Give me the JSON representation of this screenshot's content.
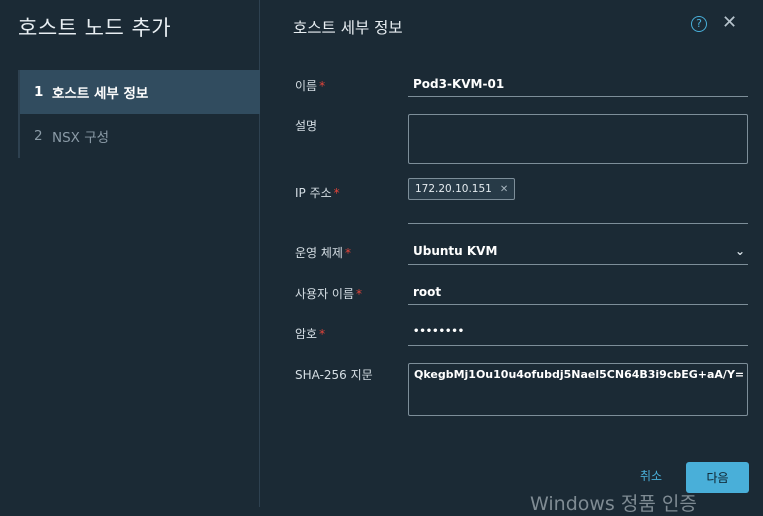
{
  "wizard": {
    "title": "호스트 노드 추가",
    "steps": [
      {
        "num": "1",
        "label": "호스트 세부 정보"
      },
      {
        "num": "2",
        "label": "NSX 구성"
      }
    ]
  },
  "section": {
    "title": "호스트 세부 정보"
  },
  "icons": {
    "help": "help-circle-icon",
    "close": "close-icon",
    "chip_remove": "remove-icon",
    "dropdown": "chevron-down-icon"
  },
  "form": {
    "name": {
      "label": "이름",
      "value": "Pod3-KVM-01"
    },
    "description": {
      "label": "설명",
      "value": ""
    },
    "ip": {
      "label": "IP 주소",
      "chip": "172.20.10.151"
    },
    "os": {
      "label": "운영 체제",
      "value": "Ubuntu KVM"
    },
    "username": {
      "label": "사용자 이름",
      "value": "root"
    },
    "password": {
      "label": "암호",
      "value": "••••••••"
    },
    "sha": {
      "label": "SHA-256 지문",
      "value": "QkegbMj1Ou10u4ofubdj5Nael5CN64B3i9cbEG+aA/Y="
    }
  },
  "actions": {
    "cancel": "취소",
    "next": "다음"
  },
  "watermark": "Windows 정품 인증",
  "colors": {
    "accent": "#49afd9",
    "required": "#e3443a",
    "background": "#1b2a35"
  }
}
